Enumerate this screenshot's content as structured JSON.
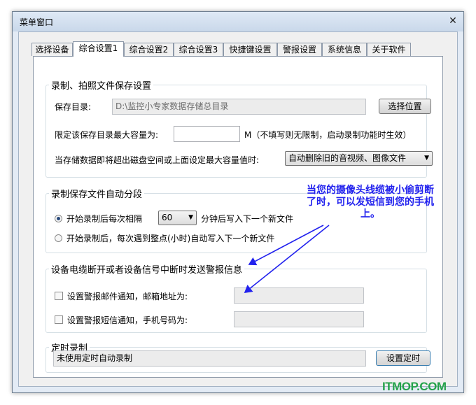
{
  "window": {
    "title": "菜单窗口",
    "close_glyph": "✕"
  },
  "tabs": [
    {
      "label": "选择设备"
    },
    {
      "label": "综合设置1"
    },
    {
      "label": "综合设置2"
    },
    {
      "label": "综合设置3"
    },
    {
      "label": "快捷键设置"
    },
    {
      "label": "警报设置"
    },
    {
      "label": "系统信息"
    },
    {
      "label": "关于软件"
    }
  ],
  "recording_save": {
    "title": "录制、拍照文件保存设置",
    "dir_label": "保存目录:",
    "dir_value": "D:\\监控小专家数据存储总目录",
    "choose_button": "选择位置",
    "max_label": "限定该保存目录最大容量为:",
    "max_value": "",
    "max_unit_note": "M（不填写则无限制，启动录制功能时生效）",
    "overflow_label": "当存储数据即将超出磁盘空间或上面设定最大容量值时:",
    "overflow_option": "自动删除旧的音视频、图像文件"
  },
  "auto_segment": {
    "title": "录制保存文件自动分段",
    "option1_prefix": "开始录制后每次相隔",
    "interval_value": "60",
    "option1_suffix": "分钟后写入下一个新文件",
    "option2_label": "开始录制后，每次遇到整点(小时)自动写入下一个新文件"
  },
  "alarm": {
    "title": "设备电缆断开或者设备信号中断时发送警报信息",
    "email_label": "设置警报邮件通知，邮箱地址为:",
    "email_value": "",
    "sms_label": "设置警报短信通知，手机号码为:",
    "sms_value": ""
  },
  "timed_record": {
    "title": "定时录制",
    "status": "未使用定时自动录制",
    "button": "设置定时"
  },
  "callout": {
    "text": "当您的摄像头线缆被小偷剪断了时，可以发短信到您的手机上。",
    "color": "#2222ee"
  },
  "watermark": {
    "text": "ITMOP.COM"
  }
}
